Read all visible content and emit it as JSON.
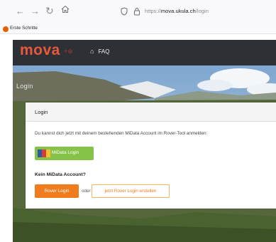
{
  "browser": {
    "url_prefix": "https://",
    "url_host": "mova.ukula.ch",
    "url_path": "/login",
    "bookmark": "Erste Schritte",
    "icons": {
      "back": "arrow-left-icon",
      "forward": "arrow-right-icon",
      "reload": "reload-icon",
      "home": "home-icon",
      "shield": "shield-icon",
      "lock": "lock-icon"
    }
  },
  "site": {
    "logo": "mova",
    "logo_suffix": "+⊕",
    "nav": {
      "faq": "FAQ"
    },
    "hero_title": "Login"
  },
  "login_card": {
    "title": "Login",
    "description": "Du kannst dich jetzt mit deinem bestehenden MiData Account im Rover-Tool anmelden:",
    "midata_button": "MiData Login",
    "no_account_label": "Kein MiData Account?",
    "rover_login_button": "Rover Login",
    "or_text": "oder",
    "create_button": "jetzt Rover Login erstellen"
  },
  "colors": {
    "header_bg": "#2d3035",
    "logo": "#e8593b",
    "midata_green": "#86c248",
    "rover_orange": "#f17c1e"
  }
}
